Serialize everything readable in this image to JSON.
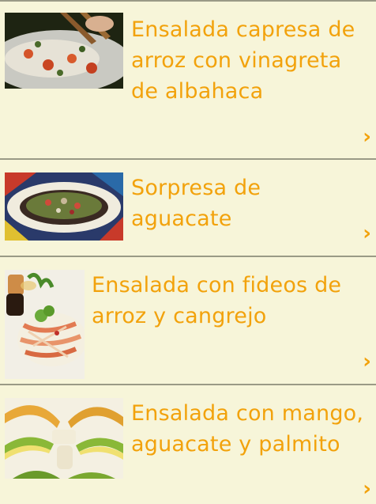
{
  "recipes": [
    {
      "title": "Ensalada capresa de arroz con vinagreta de albahaca",
      "thumb_icon": "rice-salad-photo",
      "chevron": "›"
    },
    {
      "title": "Sorpresa de aguacate",
      "thumb_icon": "avocado-dish-photo",
      "chevron": "›"
    },
    {
      "title": "Ensalada con fideos de arroz y cangrejo",
      "thumb_icon": "noodle-salad-photo",
      "chevron": "›"
    },
    {
      "title": "Ensalada con mango, aguacate y palmito",
      "thumb_icon": "mango-salad-photo",
      "chevron": "›"
    }
  ],
  "colors": {
    "background": "#f7f5d9",
    "title": "#f2a20c",
    "divider": "#9a9a86"
  }
}
